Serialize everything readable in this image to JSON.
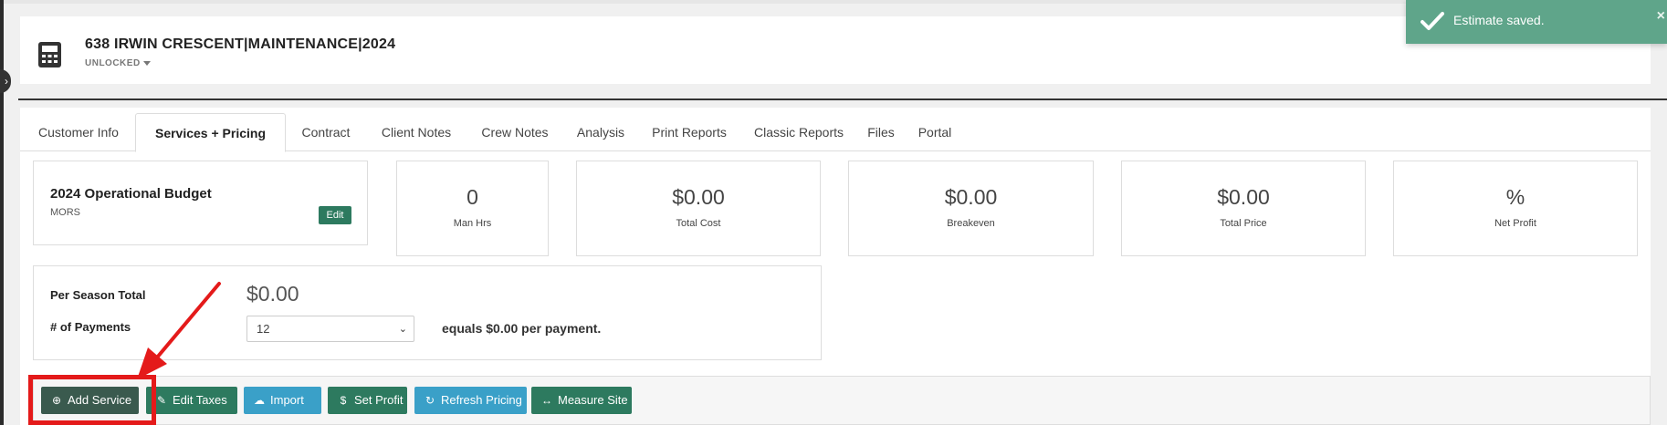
{
  "header": {
    "title": "638 IRWIN CRESCENT|MAINTENANCE|2024",
    "status": "UNLOCKED",
    "icon": "calculator-icon"
  },
  "toast": {
    "message": "Estimate saved.",
    "close": "×",
    "icon": "checkmark-icon"
  },
  "tabs": [
    {
      "label": "Customer Info"
    },
    {
      "label": "Services + Pricing",
      "active": true
    },
    {
      "label": "Contract"
    },
    {
      "label": "Client Notes"
    },
    {
      "label": "Crew Notes"
    },
    {
      "label": "Analysis"
    },
    {
      "label": "Print Reports"
    },
    {
      "label": "Classic Reports"
    },
    {
      "label": "Files"
    },
    {
      "label": "Portal"
    }
  ],
  "budget": {
    "title": "2024 Operational Budget",
    "subtitle": "MORS",
    "edit_label": "Edit"
  },
  "stats": [
    {
      "value": "0",
      "label": "Man Hrs"
    },
    {
      "value": "$0.00",
      "label": "Total Cost"
    },
    {
      "value": "$0.00",
      "label": "Breakeven"
    },
    {
      "value": "$0.00",
      "label": "Total Price"
    },
    {
      "value": "%",
      "label": "Net Profit"
    }
  ],
  "season": {
    "total_label": "Per Season Total",
    "total_value": "$0.00",
    "payments_label": "# of Payments",
    "payments_value": "12",
    "payment_text": "equals $0.00 per payment."
  },
  "toolbar": {
    "add_service": "Add Service",
    "edit_taxes": "Edit Taxes",
    "import": "Import",
    "set_profit": "Set Profit",
    "refresh_pricing": "Refresh Pricing",
    "measure_site": "Measure Site"
  },
  "colors": {
    "primary_green": "#2d7a5f",
    "info_blue": "#3aa0c8",
    "toast_green": "#5fa58a",
    "annotation_red": "#e41a1a"
  }
}
